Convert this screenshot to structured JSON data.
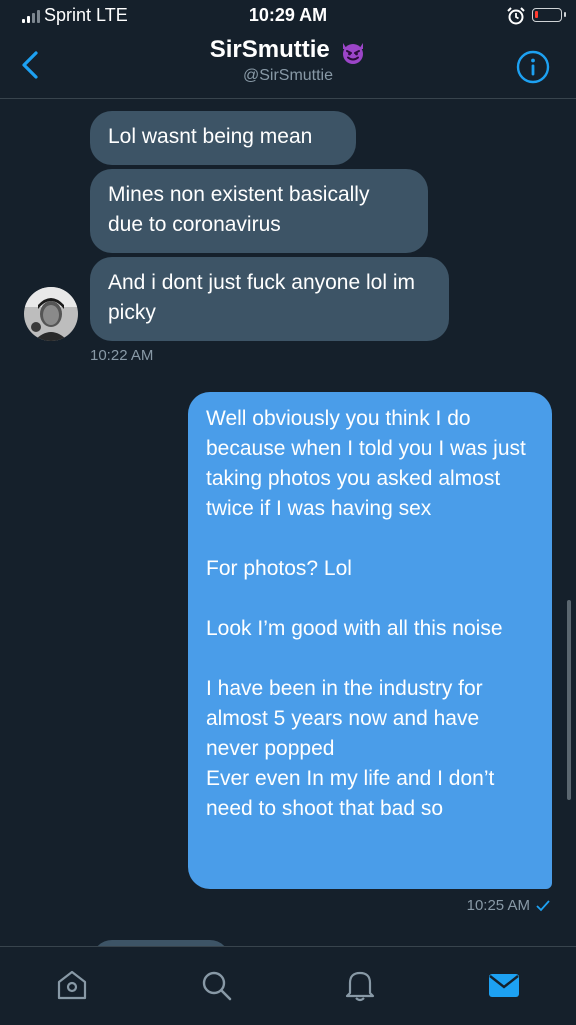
{
  "status_bar": {
    "carrier": "Sprint  LTE",
    "time": "10:29 AM"
  },
  "header": {
    "name": "SirSmuttie",
    "handle": "@SirSmuttie"
  },
  "messages_in": [
    {
      "text": "Lol wasnt being mean"
    },
    {
      "text": "Mines non existent basically due to coronavirus"
    },
    {
      "text": "And i dont just fuck anyone lol im picky"
    }
  ],
  "incoming_time": "10:22 AM",
  "message_out": {
    "text": "Well obviously you think I do because when I told you I was just taking photos you asked almost twice if I was having sex\n\nFor photos? Lol\n\nLook I’m good with all this noise\n\nI have been in the industry for almost 5 years now and have never popped\nEver even In my life and I don’t need to shoot that bad so",
    "time": "10:25 AM"
  },
  "icons": [
    "signal-icon",
    "alarm-icon",
    "battery-icon",
    "back-icon",
    "devil-emoji-icon",
    "info-icon",
    "home-icon",
    "search-icon",
    "notifications-icon",
    "messages-icon",
    "read-check-icon"
  ],
  "colors": {
    "background": "#15202b",
    "incoming_bubble": "#3d5466",
    "outgoing_bubble": "#4a9de9",
    "accent": "#1da1f2"
  }
}
